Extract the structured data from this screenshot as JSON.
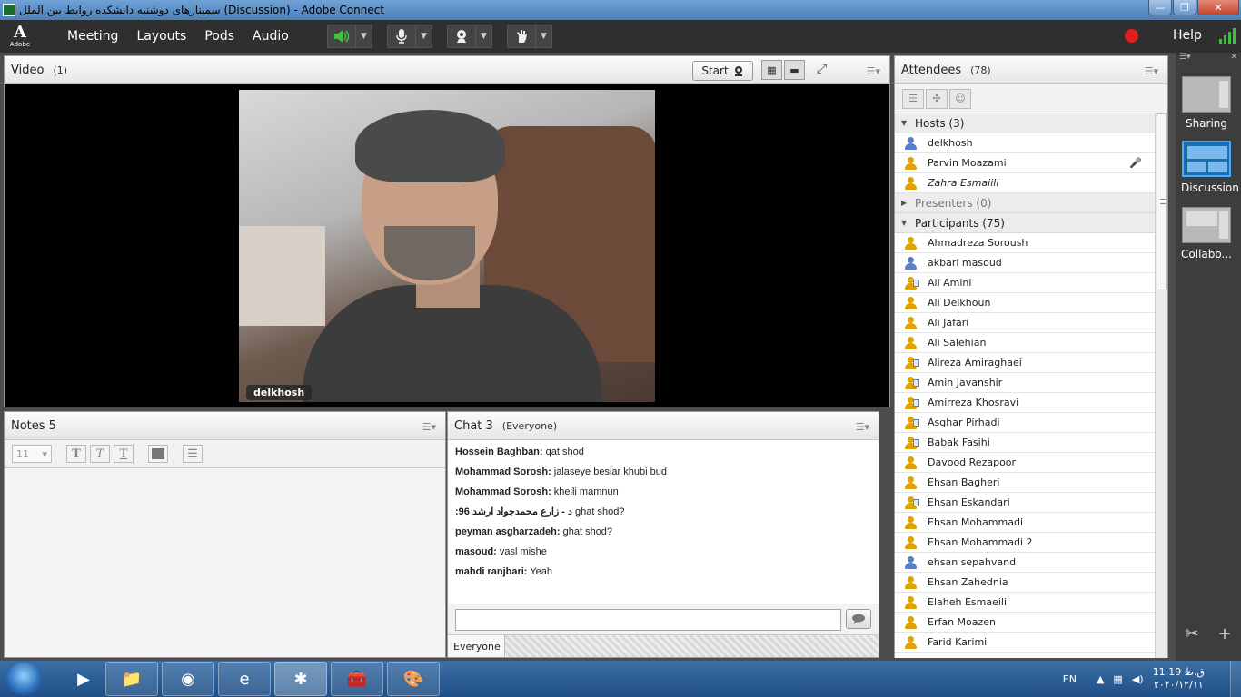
{
  "window": {
    "title": "سمینارهای دوشنبه دانشکده روابط بین الملل (Discussion) - Adobe Connect",
    "min_glyph": "—",
    "max_glyph": "❐",
    "close_glyph": "✕"
  },
  "menubar": {
    "logo_text": "Adobe",
    "items": [
      "Meeting",
      "Layouts",
      "Pods",
      "Audio"
    ],
    "help": "Help"
  },
  "video": {
    "title": "Video",
    "count": "(1)",
    "start_label": "Start",
    "presenter_name": "delkhosh"
  },
  "notes": {
    "title": "Notes 5",
    "font_size": "11"
  },
  "chat": {
    "title": "Chat 3",
    "audience": "(Everyone)",
    "tab_label": "Everyone",
    "messages": [
      {
        "sender": "Hossein Baghban:",
        "text": "qat shod"
      },
      {
        "sender": "Mohammad Sorosh:",
        "text": "jalaseye besiar khubi bud"
      },
      {
        "sender": "Mohammad Sorosh:",
        "text": "kheili mamnun"
      },
      {
        "sender": "د - زارع محمدجواد ارشد 96:",
        "text": "ghat shod?"
      },
      {
        "sender": "peyman asgharzadeh:",
        "text": "ghat shod?"
      },
      {
        "sender": "masoud:",
        "text": "vasl mishe"
      },
      {
        "sender": "mahdi ranjbari:",
        "text": "Yeah"
      }
    ]
  },
  "attendees": {
    "title": "Attendees",
    "count": "(78)",
    "hosts_label": "Hosts (3)",
    "hosts": [
      "delkhosh",
      "Parvin Moazami",
      "Zahra Esmaiili"
    ],
    "presenters_label": "Presenters (0)",
    "participants_label": "Participants (75)",
    "participants": [
      "Ahmadreza Soroush",
      "akbari masoud",
      "Ali Amini",
      "Ali Delkhoun",
      "Ali Jafari",
      "Ali Salehian",
      "Alireza Amiraghaei",
      "Amin Javanshir",
      "Amirreza Khosravi",
      "Asghar Pirhadi",
      "Babak Fasihi",
      "Davood Rezapoor",
      "Ehsan Bagheri",
      "Ehsan Eskandari",
      "Ehsan Mohammadi",
      "Ehsan Mohammadi 2",
      "ehsan sepahvand",
      "Ehsan Zahednia",
      "Elaheh Esmaeili",
      "Erfan Moazen",
      "Farid Karimi"
    ]
  },
  "layouts_panel": {
    "items": [
      "Sharing",
      "Discussion",
      "Collabo..."
    ],
    "active": "Discussion"
  },
  "taskbar": {
    "language": "EN",
    "time": "11:19 ق.ظ",
    "date": "۲۰۲۰/۱۲/۱۱"
  },
  "colors": {
    "menubar_bg": "#2f2f2f",
    "record_red": "#e0201e",
    "signal_green": "#3ec13e",
    "active_layout": "#1e6fb0"
  }
}
